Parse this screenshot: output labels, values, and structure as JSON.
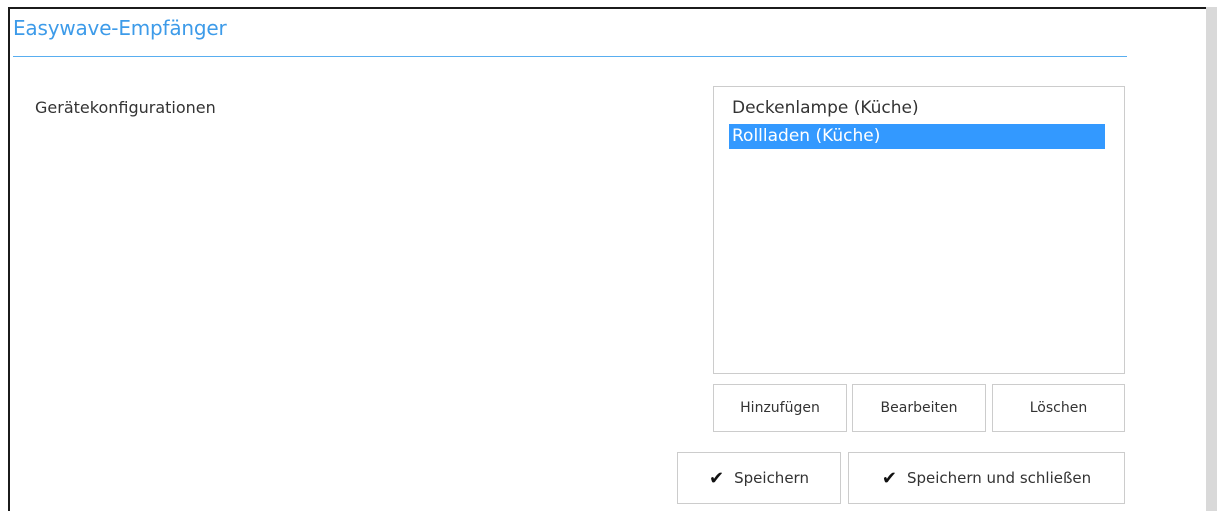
{
  "dialog": {
    "title": "Easywave-Empfänger"
  },
  "config": {
    "label": "Gerätekonfigurationen",
    "items": [
      {
        "label": "Deckenlampe (Küche)",
        "selected": false
      },
      {
        "label": "Rollladen (Küche)",
        "selected": true
      }
    ],
    "buttons": {
      "add": "Hinzufügen",
      "edit": "Bearbeiten",
      "delete": "Löschen"
    }
  },
  "footer": {
    "save": "Speichern",
    "save_close": "Speichern und schließen",
    "check_icon": "checkmark-icon"
  },
  "colors": {
    "accent": "#3d9be9",
    "selection": "#3399ff"
  }
}
